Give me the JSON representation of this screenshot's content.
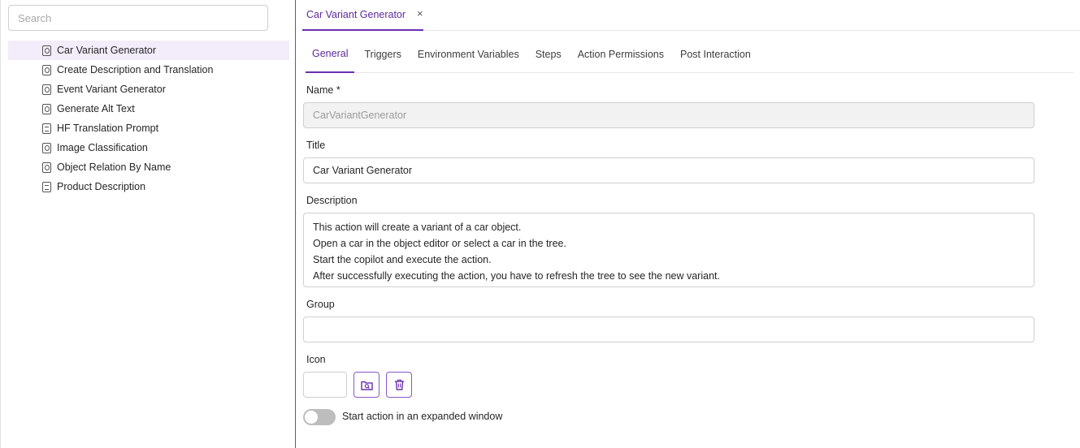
{
  "sidebar": {
    "search_placeholder": "Search",
    "items": [
      {
        "label": "Car Variant Generator",
        "icon": "action-icon",
        "selected": true
      },
      {
        "label": "Create Description and Translation",
        "icon": "action-icon"
      },
      {
        "label": "Event Variant Generator",
        "icon": "action-icon"
      },
      {
        "label": "Generate Alt Text",
        "icon": "action-icon"
      },
      {
        "label": "HF Translation Prompt",
        "icon": "prompt-icon"
      },
      {
        "label": "Image Classification",
        "icon": "action-icon"
      },
      {
        "label": "Object Relation By Name",
        "icon": "action-icon"
      },
      {
        "label": "Product Description",
        "icon": "prompt-icon"
      }
    ]
  },
  "doc_tab": {
    "label": "Car Variant Generator",
    "close": "×"
  },
  "tabs": [
    "General",
    "Triggers",
    "Environment Variables",
    "Steps",
    "Action Permissions",
    "Post Interaction"
  ],
  "form": {
    "name_label": "Name *",
    "name_value": "CarVariantGenerator",
    "title_label": "Title",
    "title_value": "Car Variant Generator",
    "description_label": "Description",
    "description_lines": [
      "This action will create a variant of a car object.",
      "Open a car in the object editor or select a car in the tree.",
      "Start the copilot and execute the action.",
      "After successfully executing the action, you have to refresh the tree to see the new variant."
    ],
    "group_label": "Group",
    "group_value": "",
    "icon_label": "Icon",
    "toggle_label": "Start action in an expanded window",
    "toggle_on": false
  },
  "colors": {
    "accent": "#6a2fb2",
    "selected_bg": "#f3ecfb"
  }
}
